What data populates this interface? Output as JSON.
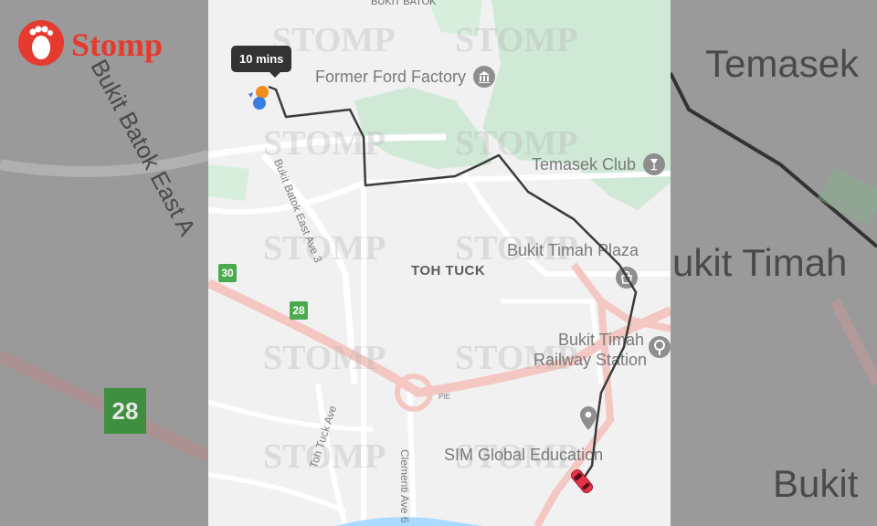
{
  "brand": {
    "logo_text": "Stomp",
    "watermark_text": "STOMP",
    "accent_color": "#e53a2e"
  },
  "eta": {
    "label": "10 mins"
  },
  "places": {
    "bukit_batok": "BUKIT BATOK",
    "former_ford_factory": "Former Ford Factory",
    "temasek_club": "Temasek Club",
    "toh_tuck": "TOH TUCK",
    "bukit_timah_plaza": "Bukit Timah Plaza",
    "railway_line1": "Bukit Timah",
    "railway_line2": "Railway Station",
    "sim_global": "SIM Global Education"
  },
  "roads": {
    "bukit_batok_east_ave_3": "Bukit Batok East Ave 3",
    "toh_tuck_ave": "Toh Tuck Ave",
    "clementi_ave_6": "Clementi Ave 6",
    "pie": "PIE"
  },
  "route_badges": [
    "30",
    "28"
  ],
  "backdrop": {
    "left_road": "Bukit Batok East A",
    "left_badge": "28",
    "right_place1": "Temasek",
    "right_place2": "ukit Timah",
    "right_place3": "Bukit"
  },
  "icons": [
    "stomp-foot-icon",
    "museum-icon",
    "club-icon",
    "shopping-icon",
    "train-icon",
    "place-pin-icon",
    "origin-marker-icon",
    "car-icon"
  ],
  "colors": {
    "map_bg": "#f1f1f1",
    "park": "#cfe9d6",
    "route": "#3b3b3b",
    "expressway": "#f4c7c2",
    "badge_green": "#4caa4e",
    "car": "#e3344a"
  }
}
